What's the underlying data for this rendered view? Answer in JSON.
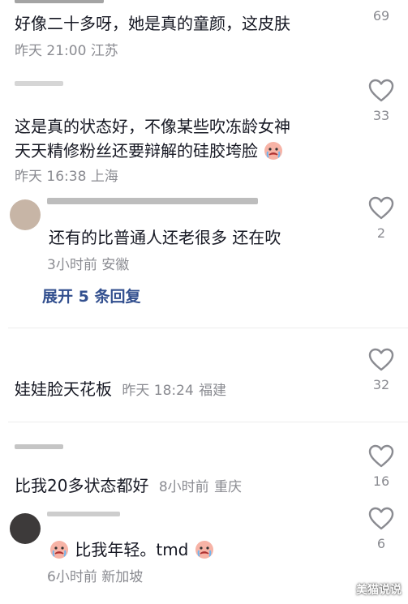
{
  "comments": [
    {
      "text": "好像二十多呀，她是真的童颜，这皮肤",
      "time": "昨天 21:00",
      "location": "江苏",
      "likes": "69"
    },
    {
      "text_line1": "这是真的状态好，不像某些吹冻龄女神",
      "text_line2": "天天精修粉丝还要辩解的硅胶垮脸",
      "time": "昨天 16:38",
      "location": "上海",
      "likes": "33"
    },
    {
      "text": "还有的比普通人还老很多 还在吹",
      "time": "3小时前",
      "location": "安徽",
      "likes": "2"
    },
    {
      "text": "娃娃脸天花板",
      "time": "昨天 18:24",
      "location": "福建",
      "likes": "32"
    },
    {
      "text": "比我20多状态都好",
      "time": "8小时前",
      "location": "重庆",
      "likes": "16"
    },
    {
      "text": "比我年轻。tmd",
      "time": "6小时前",
      "location": "新加坡",
      "likes": "6"
    }
  ],
  "expand_replies": "展开 5 条回复",
  "watermark": "美猫说说",
  "icons": {
    "like": "heart-outline-icon",
    "emoji": "crying-face-emoji"
  },
  "colors": {
    "text": "#161823",
    "meta": "#8a8b91",
    "expand": "#33508f",
    "divider": "#ededed"
  }
}
